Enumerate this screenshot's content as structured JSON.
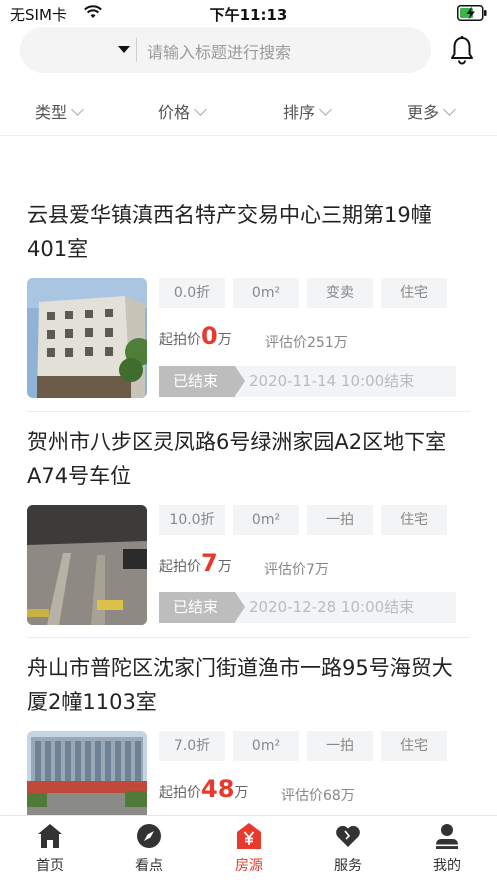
{
  "status_bar": {
    "carrier": "无SIM卡",
    "time": "下午11:13",
    "icons": [
      "wifi-icon",
      "battery-charging-icon"
    ]
  },
  "search": {
    "placeholder": "请输入标题进行搜索",
    "icon": "bell-icon"
  },
  "filters": [
    {
      "label": "类型"
    },
    {
      "label": "价格"
    },
    {
      "label": "排序"
    },
    {
      "label": "更多"
    }
  ],
  "listings": [
    {
      "title": "云县爱华镇滇西名特产交易中心三期第19幢401室",
      "tags": [
        "0.0折",
        "0m²",
        "变卖",
        "住宅"
      ],
      "start_label": "起拍价",
      "start_price": "0",
      "start_unit": "万",
      "eval": "评估价251万",
      "status": "已结束",
      "end_time": "2020-11-14 10:00结束"
    },
    {
      "title": "贺州市八步区灵凤路6号绿洲家园A2区地下室A74号车位",
      "tags": [
        "10.0折",
        "0m²",
        "一拍",
        "住宅"
      ],
      "start_label": "起拍价",
      "start_price": "7",
      "start_unit": "万",
      "eval": "评估价7万",
      "status": "已结束",
      "end_time": "2020-12-28 10:00结束"
    },
    {
      "title": "舟山市普陀区沈家门街道渔市一路95号海贸大厦2幢1103室",
      "tags": [
        "7.0折",
        "0m²",
        "一拍",
        "住宅"
      ],
      "start_label": "起拍价",
      "start_price": "48",
      "start_unit": "万",
      "eval": "评估价68万"
    }
  ],
  "tabs": [
    {
      "label": "首页",
      "icon": "home-icon"
    },
    {
      "label": "看点",
      "icon": "compass-icon"
    },
    {
      "label": "房源",
      "icon": "house-yen-icon",
      "active": true
    },
    {
      "label": "服务",
      "icon": "heart-icon"
    },
    {
      "label": "我的",
      "icon": "person-icon"
    }
  ],
  "colors": {
    "accent": "#e8392c",
    "tag_bg": "#f3f4f6",
    "status_pill": "#bdbdbd"
  }
}
